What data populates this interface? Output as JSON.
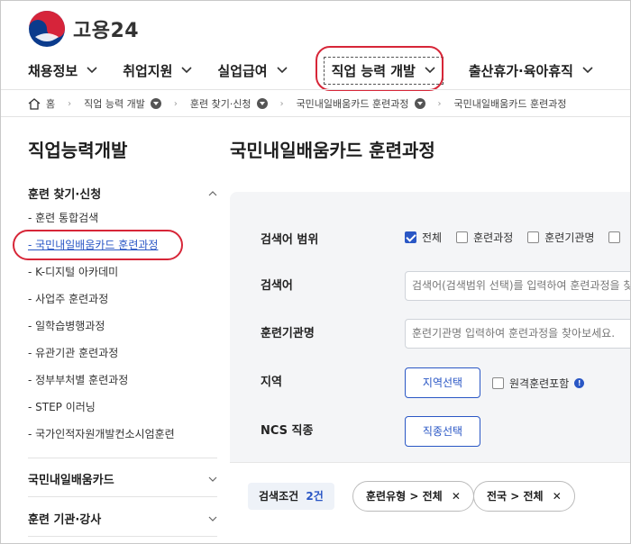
{
  "header": {
    "logo_text": "고용24",
    "nav": [
      {
        "label": "채용정보"
      },
      {
        "label": "취업지원"
      },
      {
        "label": "실업급여"
      },
      {
        "label": "직업 능력 개발"
      },
      {
        "label": "출산휴가·육아휴직"
      }
    ]
  },
  "breadcrumb": {
    "home": "홈",
    "items": [
      "직업 능력 개발",
      "훈련 찾기·신청",
      "국민내일배움카드 훈련과정",
      "국민내일배움카드 훈련과정"
    ]
  },
  "sidebar": {
    "title": "직업능력개발",
    "group1": "훈련 찾기·신청",
    "items": [
      "- 훈련 통합검색",
      "- 국민내일배움카드 훈련과정",
      "- K-디지털 아카데미",
      "- 사업주 훈련과정",
      "- 일학습병행과정",
      "- 유관기관 훈련과정",
      "- 정부부처별 훈련과정",
      "- STEP 이러닝",
      "- 국가인적자원개발컨소시엄훈련"
    ],
    "group2": "국민내일배움카드",
    "group3": "훈련 기관·강사"
  },
  "main": {
    "title": "국민내일배움카드 훈련과정",
    "search_scope": {
      "label": "검색어 범위",
      "options": [
        {
          "label": "전체",
          "checked": true
        },
        {
          "label": "훈련과정",
          "checked": false
        },
        {
          "label": "훈련기관명",
          "checked": false
        }
      ]
    },
    "keyword": {
      "label": "검색어",
      "placeholder": "검색어(검색범위 선택)를 입력하여 훈련과정을 찾아보세요."
    },
    "institution": {
      "label": "훈련기관명",
      "placeholder": "훈련기관명 입력하여 훈련과정을 찾아보세요."
    },
    "region": {
      "label": "지역",
      "button": "지역선택",
      "remote_label": "원격훈련포함",
      "info": "!"
    },
    "ncs": {
      "label": "NCS 직종",
      "button": "직종선택"
    },
    "conditions": {
      "label": "검색조건",
      "count": "2건",
      "chips": [
        "훈련유형 > 전체",
        "전국 > 전체"
      ]
    }
  },
  "colors": {
    "accent": "#2a57c5",
    "highlight": "#d72638",
    "panel": "#f4f5f7"
  }
}
